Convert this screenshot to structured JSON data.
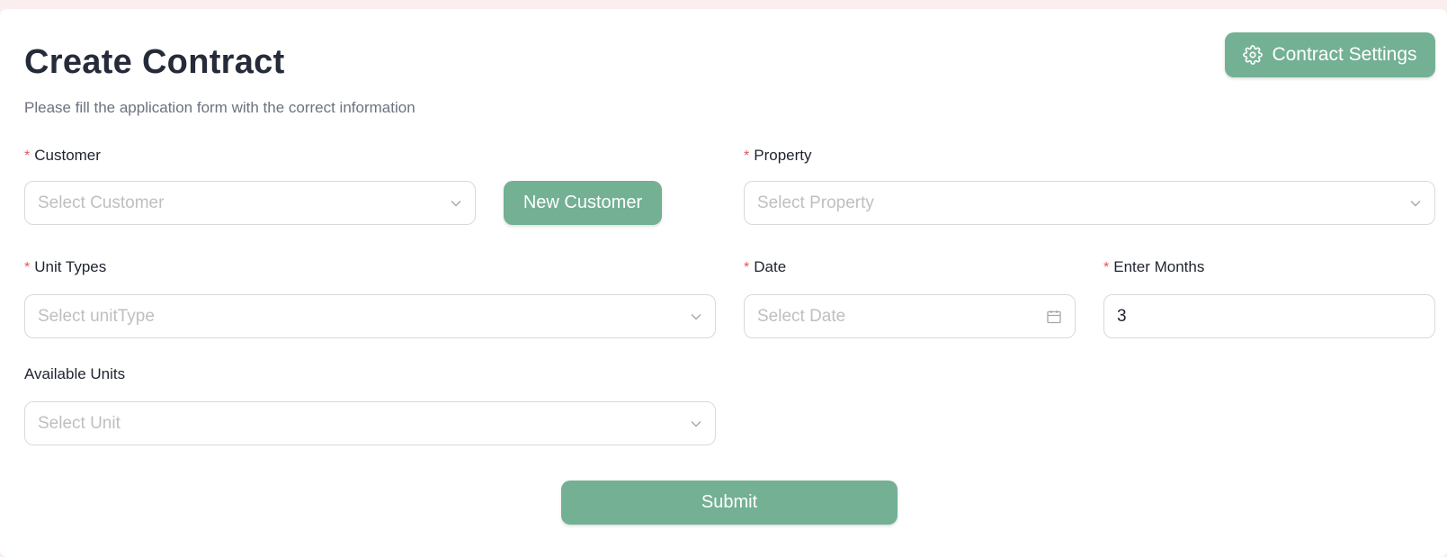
{
  "header": {
    "title": "Create Contract",
    "subtitle": "Please fill the application form with the correct information",
    "settings_button_label": "Contract Settings",
    "settings_icon": "gear-icon"
  },
  "form": {
    "customer": {
      "label": "Customer",
      "required_mark": "*",
      "placeholder": "Select Customer",
      "icon": "chevron-down-icon"
    },
    "new_customer_button_label": "New Customer",
    "property": {
      "label": "Property",
      "required_mark": "*",
      "placeholder": "Select Property",
      "icon": "chevron-down-icon"
    },
    "unit_types": {
      "label": "Unit Types",
      "required_mark": "*",
      "placeholder": "Select unitType",
      "icon": "chevron-down-icon"
    },
    "date": {
      "label": "Date",
      "required_mark": "*",
      "placeholder": "Select Date",
      "icon": "calendar-icon"
    },
    "months": {
      "label": "Enter Months",
      "required_mark": "*",
      "value": "3"
    },
    "available_units": {
      "label": "Available Units",
      "placeholder": "Select Unit",
      "icon": "chevron-down-icon"
    },
    "submit_label": "Submit"
  },
  "colors": {
    "accent": "#73b094",
    "required": "#e25b5b",
    "title": "#262b3a",
    "placeholder": "#bfbfbf",
    "border": "#d9d9d9"
  }
}
